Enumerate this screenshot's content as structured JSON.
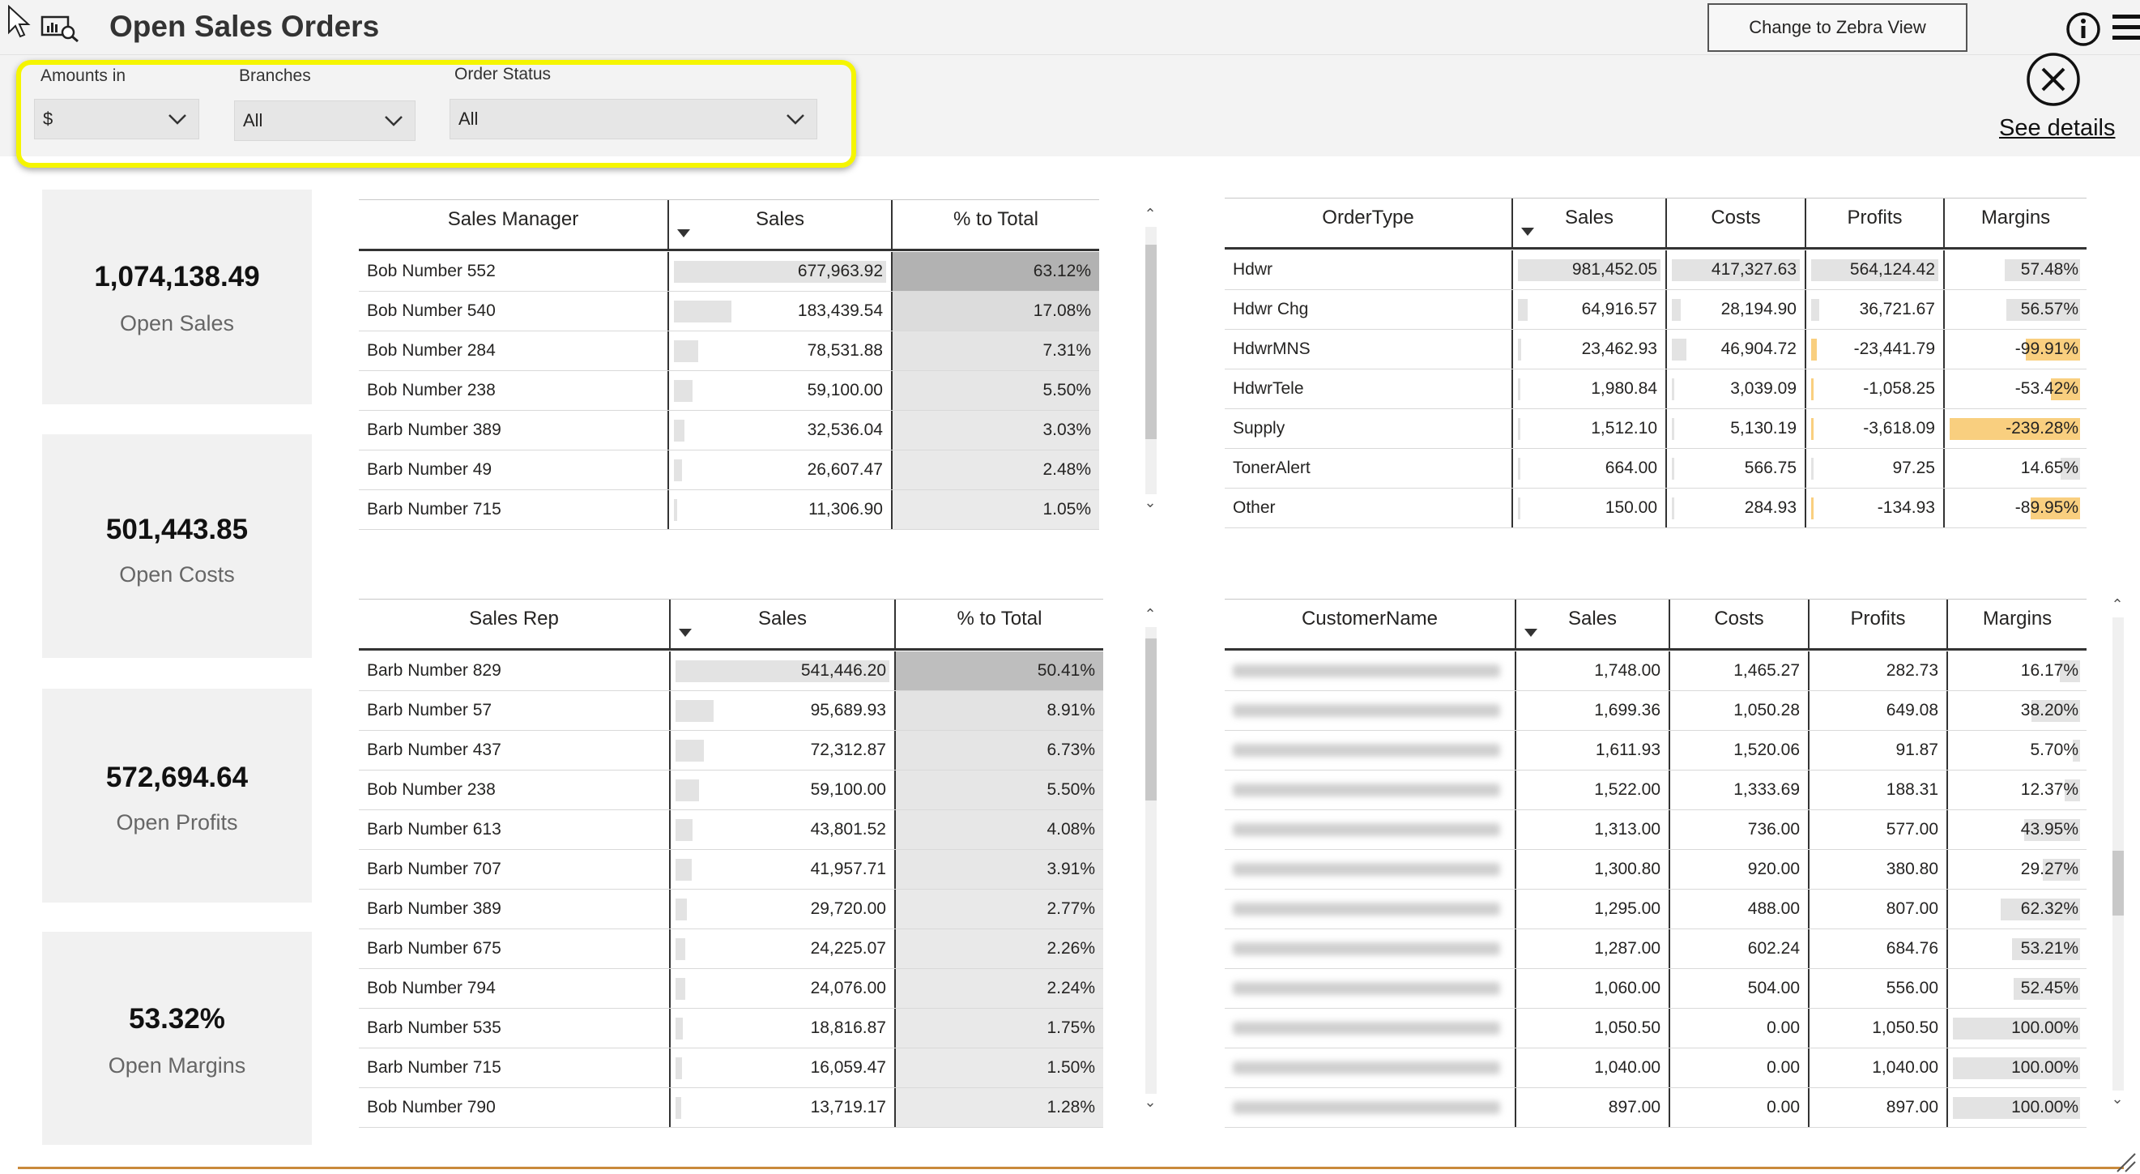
{
  "header": {
    "title": "Open Sales Orders",
    "zebra_button": "Change to Zebra View"
  },
  "filters": {
    "amounts": {
      "label": "Amounts in",
      "value": "$"
    },
    "branches": {
      "label": "Branches",
      "value": "All"
    },
    "order_status": {
      "label": "Order Status",
      "value": "All"
    }
  },
  "details": {
    "link": "See details"
  },
  "kpis": [
    {
      "value": "1,074,138.49",
      "label": "Open Sales"
    },
    {
      "value": "501,443.85",
      "label": "Open Costs"
    },
    {
      "value": "572,694.64",
      "label": "Open Profits"
    },
    {
      "value": "53.32%",
      "label": "Open Margins"
    }
  ],
  "sales_manager_table": {
    "columns": [
      "Sales Manager",
      "Sales",
      "% to Total"
    ],
    "rows": [
      {
        "name": "Bob Number 552",
        "sales": "677,963.92",
        "pct": "63.12%",
        "sales_frac": 1.0,
        "pct_frac": 0.6312
      },
      {
        "name": "Bob Number 540",
        "sales": "183,439.54",
        "pct": "17.08%",
        "sales_frac": 0.2706,
        "pct_frac": 0.1708
      },
      {
        "name": "Bob Number 284",
        "sales": "78,531.88",
        "pct": "7.31%",
        "sales_frac": 0.1158,
        "pct_frac": 0.0731
      },
      {
        "name": "Bob Number 238",
        "sales": "59,100.00",
        "pct": "5.50%",
        "sales_frac": 0.0872,
        "pct_frac": 0.055
      },
      {
        "name": "Barb Number 389",
        "sales": "32,536.04",
        "pct": "3.03%",
        "sales_frac": 0.048,
        "pct_frac": 0.0303
      },
      {
        "name": "Barb Number 49",
        "sales": "26,607.47",
        "pct": "2.48%",
        "sales_frac": 0.0392,
        "pct_frac": 0.0248
      },
      {
        "name": "Barb Number 715",
        "sales": "11,306.90",
        "pct": "1.05%",
        "sales_frac": 0.0167,
        "pct_frac": 0.0105
      }
    ]
  },
  "order_type_table": {
    "columns": [
      "OrderType",
      "Sales",
      "Costs",
      "Profits",
      "Margins"
    ],
    "rows": [
      {
        "name": "Hdwr",
        "sales": "981,452.05",
        "costs": "417,327.63",
        "profits": "564,124.42",
        "margins": "57.48%",
        "s": 1.0,
        "c": 1.0,
        "p": 1.0,
        "m": 0.5748,
        "neg": false
      },
      {
        "name": "Hdwr Chg",
        "sales": "64,916.57",
        "costs": "28,194.90",
        "profits": "36,721.67",
        "margins": "56.57%",
        "s": 0.0661,
        "c": 0.0676,
        "p": 0.0651,
        "m": 0.5657,
        "neg": false
      },
      {
        "name": "HdwrMNS",
        "sales": "23,462.93",
        "costs": "46,904.72",
        "profits": "-23,441.79",
        "margins": "-99.91%",
        "s": 0.0239,
        "c": 0.1124,
        "p": 0.0416,
        "m": 0.4176,
        "neg": true
      },
      {
        "name": "HdwrTele",
        "sales": "1,980.84",
        "costs": "3,039.09",
        "profits": "-1,058.25",
        "margins": "-53.42%",
        "s": 0.002,
        "c": 0.0073,
        "p": 0.0019,
        "m": 0.2233,
        "neg": true
      },
      {
        "name": "Supply",
        "sales": "1,512.10",
        "costs": "5,130.19",
        "profits": "-3,618.09",
        "margins": "-239.28%",
        "s": 0.0015,
        "c": 0.0123,
        "p": 0.0064,
        "m": 1.0,
        "neg": true
      },
      {
        "name": "TonerAlert",
        "sales": "664.00",
        "costs": "566.75",
        "profits": "97.25",
        "margins": "14.65%",
        "s": 0.0007,
        "c": 0.0014,
        "p": 0.0002,
        "m": 0.1465,
        "neg": false
      },
      {
        "name": "Other",
        "sales": "150.00",
        "costs": "284.93",
        "profits": "-134.93",
        "margins": "-89.95%",
        "s": 0.0002,
        "c": 0.0007,
        "p": 0.0002,
        "m": 0.3759,
        "neg": true
      }
    ]
  },
  "sales_rep_table": {
    "columns": [
      "Sales Rep",
      "Sales",
      "% to Total"
    ],
    "rows": [
      {
        "name": "Barb Number 829",
        "sales": "541,446.20",
        "pct": "50.41%",
        "sales_frac": 1.0,
        "pct_frac": 0.5041
      },
      {
        "name": "Barb Number 57",
        "sales": "95,689.93",
        "pct": "8.91%",
        "sales_frac": 0.1767,
        "pct_frac": 0.0891
      },
      {
        "name": "Barb Number 437",
        "sales": "72,312.87",
        "pct": "6.73%",
        "sales_frac": 0.1336,
        "pct_frac": 0.0673
      },
      {
        "name": "Bob Number 238",
        "sales": "59,100.00",
        "pct": "5.50%",
        "sales_frac": 0.1092,
        "pct_frac": 0.055
      },
      {
        "name": "Barb Number 613",
        "sales": "43,801.52",
        "pct": "4.08%",
        "sales_frac": 0.0809,
        "pct_frac": 0.0408
      },
      {
        "name": "Barb Number 707",
        "sales": "41,957.71",
        "pct": "3.91%",
        "sales_frac": 0.0775,
        "pct_frac": 0.0391
      },
      {
        "name": "Barb Number 389",
        "sales": "29,720.00",
        "pct": "2.77%",
        "sales_frac": 0.0549,
        "pct_frac": 0.0277
      },
      {
        "name": "Barb Number 675",
        "sales": "24,225.07",
        "pct": "2.26%",
        "sales_frac": 0.0447,
        "pct_frac": 0.0226
      },
      {
        "name": "Bob Number 794",
        "sales": "24,076.00",
        "pct": "2.24%",
        "sales_frac": 0.0445,
        "pct_frac": 0.0224
      },
      {
        "name": "Barb Number 535",
        "sales": "18,816.87",
        "pct": "1.75%",
        "sales_frac": 0.0348,
        "pct_frac": 0.0175
      },
      {
        "name": "Barb Number 715",
        "sales": "16,059.47",
        "pct": "1.50%",
        "sales_frac": 0.0297,
        "pct_frac": 0.015
      },
      {
        "name": "Bob Number 790",
        "sales": "13,719.17",
        "pct": "1.28%",
        "sales_frac": 0.0253,
        "pct_frac": 0.0128
      }
    ]
  },
  "customer_table": {
    "columns": [
      "CustomerName",
      "Sales",
      "Costs",
      "Profits",
      "Margins"
    ],
    "rows": [
      {
        "sales": "1,748.00",
        "costs": "1,465.27",
        "profits": "282.73",
        "margins": "16.17%",
        "m": 0.1617
      },
      {
        "sales": "1,699.36",
        "costs": "1,050.28",
        "profits": "649.08",
        "margins": "38.20%",
        "m": 0.382
      },
      {
        "sales": "1,611.93",
        "costs": "1,520.06",
        "profits": "91.87",
        "margins": "5.70%",
        "m": 0.057
      },
      {
        "sales": "1,522.00",
        "costs": "1,333.69",
        "profits": "188.31",
        "margins": "12.37%",
        "m": 0.1237
      },
      {
        "sales": "1,313.00",
        "costs": "736.00",
        "profits": "577.00",
        "margins": "43.95%",
        "m": 0.4395
      },
      {
        "sales": "1,300.80",
        "costs": "920.00",
        "profits": "380.80",
        "margins": "29.27%",
        "m": 0.2927
      },
      {
        "sales": "1,295.00",
        "costs": "488.00",
        "profits": "807.00",
        "margins": "62.32%",
        "m": 0.6232
      },
      {
        "sales": "1,287.00",
        "costs": "602.24",
        "profits": "684.76",
        "margins": "53.21%",
        "m": 0.5321
      },
      {
        "sales": "1,060.00",
        "costs": "504.00",
        "profits": "556.00",
        "margins": "52.45%",
        "m": 0.5245
      },
      {
        "sales": "1,050.50",
        "costs": "0.00",
        "profits": "1,050.50",
        "margins": "100.00%",
        "m": 1.0
      },
      {
        "sales": "1,040.00",
        "costs": "0.00",
        "profits": "1,040.00",
        "margins": "100.00%",
        "m": 1.0
      },
      {
        "sales": "897.00",
        "costs": "0.00",
        "profits": "897.00",
        "margins": "100.00%",
        "m": 1.0
      }
    ]
  },
  "colors": {
    "highlight": "#f5f500",
    "data_bar": "#e3e3e3",
    "negative_bar": "#f9cf7f",
    "bottom_rule": "#c98a3c",
    "pct_shade_top": "#a6a6a6"
  },
  "icons": [
    "cursor-icon",
    "report-icon",
    "info-icon",
    "hamburger-icon",
    "close-circle-icon",
    "chevron-down-icon",
    "sort-desc-icon",
    "resize-grip-icon"
  ]
}
